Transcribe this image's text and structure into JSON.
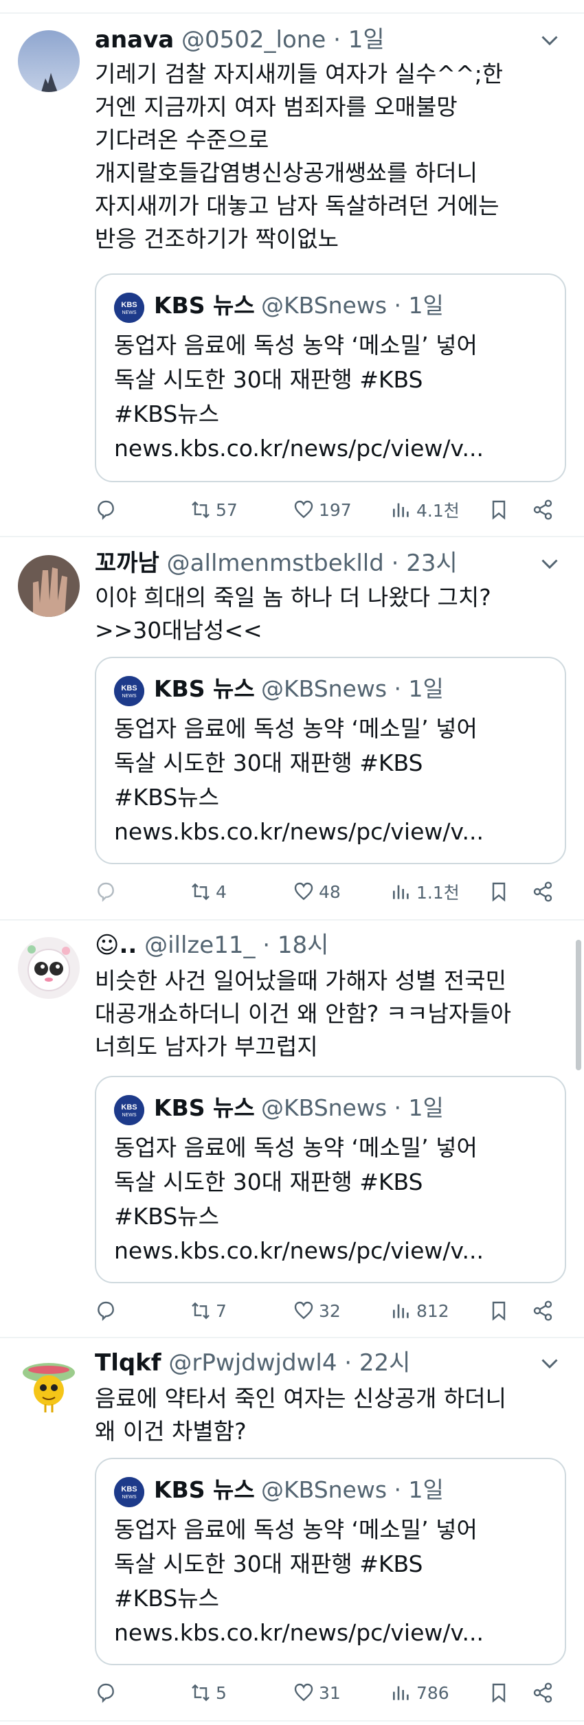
{
  "tweets": [
    {
      "name": "anava",
      "handle": "@0502_lone",
      "time": "· 1일",
      "avatar_icon": "sky-photo-avatar",
      "lines": [
        "기레기 검찰 자지새끼들 여자가 실수^^;한",
        "거엔 지금까지 여자 범죄자를 오매불망",
        "기다려온 수준으로",
        "개지랄호들갑염병신상공개쌩쑈를 하더니",
        "자지새끼가 대놓고 남자 독살하려던 거에는",
        "반응 건조하기가 짝이없노"
      ],
      "quote": {
        "name": "KBS 뉴스",
        "meta": "@KBSnews · 1일",
        "lines": [
          "동업자 음료에 독성 농약 ‘메소밀’ 넣어",
          "독살 시도한 30대 재판행 #KBS",
          "#KBS뉴스",
          "news.kbs.co.kr/news/pc/view/v..."
        ]
      },
      "stats": {
        "replies": "",
        "retweets": "57",
        "likes": "197",
        "views": "4.1천"
      }
    },
    {
      "name": "꼬까남",
      "handle": "@allmenmstbeklld",
      "time": "· 23시",
      "avatar_icon": "hand-photo-avatar",
      "lines": [
        "이야 희대의 죽일 놈 하나 더 나왔다 그치?",
        ">>30대남성<<"
      ],
      "quote": {
        "name": "KBS 뉴스",
        "meta": "@KBSnews · 1일",
        "lines": [
          "동업자 음료에 독성 농약 ‘메소밀’ 넣어",
          "독살 시도한 30대 재판행 #KBS",
          "#KBS뉴스",
          "news.kbs.co.kr/news/pc/view/v..."
        ]
      },
      "stats": {
        "replies": "",
        "retweets": "4",
        "likes": "48",
        "views": "1.1천"
      }
    },
    {
      "name": "☺..",
      "handle": "@illze11_",
      "time": "· 18시",
      "avatar_icon": "character-avatar",
      "lines": [
        "비슷한 사건 일어났을때 가해자 성별 전국민",
        "대공개쇼하더니 이건 왜 안함? ㅋㅋ남자들아",
        "너희도 남자가 부끄럽지"
      ],
      "quote": {
        "name": "KBS 뉴스",
        "meta": "@KBSnews · 1일",
        "lines": [
          "동업자 음료에 독성 농약 ‘메소밀’ 넣어",
          "독살 시도한 30대 재판행 #KBS",
          "#KBS뉴스",
          "news.kbs.co.kr/news/pc/view/v..."
        ]
      },
      "stats": {
        "replies": "",
        "retweets": "7",
        "likes": "32",
        "views": "812"
      }
    },
    {
      "name": "Tlqkf",
      "handle": "@rPwjdwjdwl4",
      "time": "· 22시",
      "avatar_icon": "yellow-creature-avatar",
      "lines": [
        "음료에 약타서 죽인 여자는 신상공개 하더니",
        "왜 이건 차별함?"
      ],
      "quote": {
        "name": "KBS 뉴스",
        "meta": "@KBSnews · 1일",
        "lines": [
          "동업자 음료에 독성 농약 ‘메소밀’ 넣어",
          "독살 시도한 30대 재판행 #KBS",
          "#KBS뉴스",
          "news.kbs.co.kr/news/pc/view/v..."
        ]
      },
      "stats": {
        "replies": "",
        "retweets": "5",
        "likes": "31",
        "views": "786"
      }
    }
  ],
  "kbs_logo_text": "KBS NEWS",
  "colors": {
    "text": "#0f1419",
    "secondary": "#536471",
    "border": "#cfd9de",
    "divider": "#eff3f4",
    "kbs_blue": "#1d3a8a"
  },
  "icons": [
    "more-icon",
    "reply-icon",
    "retweet-icon",
    "like-icon",
    "views-icon",
    "bookmark-icon",
    "share-icon"
  ]
}
